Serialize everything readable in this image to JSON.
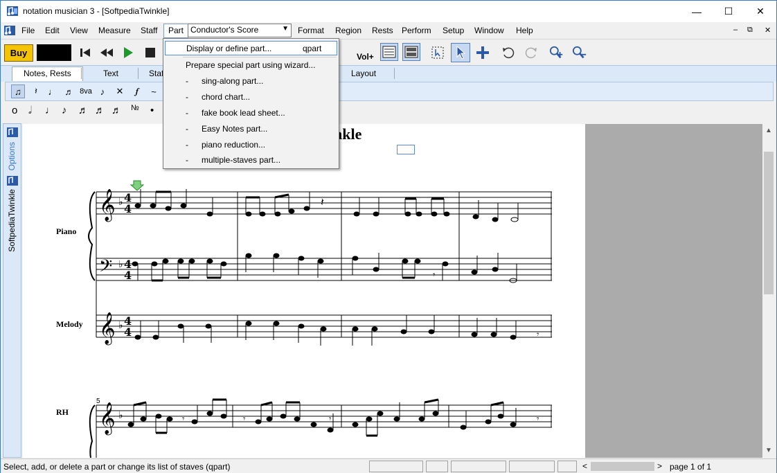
{
  "window": {
    "title": "notation musician 3 - [SoftpediaTwinkle]",
    "minimize": "—",
    "maximize": "☐",
    "close": "✕"
  },
  "menu": {
    "file": "File",
    "edit": "Edit",
    "view": "View",
    "measure": "Measure",
    "staff": "Staff",
    "part": "Part",
    "part_select": "Conductor's Score",
    "format": "Format",
    "region": "Region",
    "rests": "Rests",
    "perform": "Perform",
    "setup": "Setup",
    "window": "Window",
    "help": "Help",
    "mdi_min": "–",
    "mdi_restore": "⧉",
    "mdi_close": "✕"
  },
  "toolbar": {
    "buy": "Buy",
    "vol": "Vol+"
  },
  "tabs": {
    "notes_rests": "Notes, Rests",
    "text": "Text",
    "staff": "Staff",
    "layout": "Layout"
  },
  "palette": {
    "octave": "8va",
    "vowel": "ϕ"
  },
  "side_panel": {
    "options": "Options",
    "file_label": "SoftpediaTwinkle"
  },
  "part_menu": {
    "display_define": "Display or define part...",
    "display_shortcut": "qpart",
    "prepare_wizard": "Prepare special part using wizard...",
    "dash": "-",
    "sing_along": "sing-along part...",
    "chord_chart": "chord chart...",
    "fake_book": "fake book lead sheet...",
    "easy_notes": "Easy Notes part...",
    "piano_reduction": "piano reduction...",
    "multiple_staves": "multiple-staves part..."
  },
  "score": {
    "title": "nkle",
    "staves": {
      "piano": "Piano",
      "melody": "Melody",
      "rh": "RH"
    },
    "measure_number": "5",
    "time_sig_top": "4",
    "time_sig_bottom": "4"
  },
  "statusbar": {
    "message": "Select, add, or delete a part or change its list of staves (qpart)",
    "page": "page 1 of 1",
    "left_arrow": "<",
    "right_arrow": ">"
  }
}
